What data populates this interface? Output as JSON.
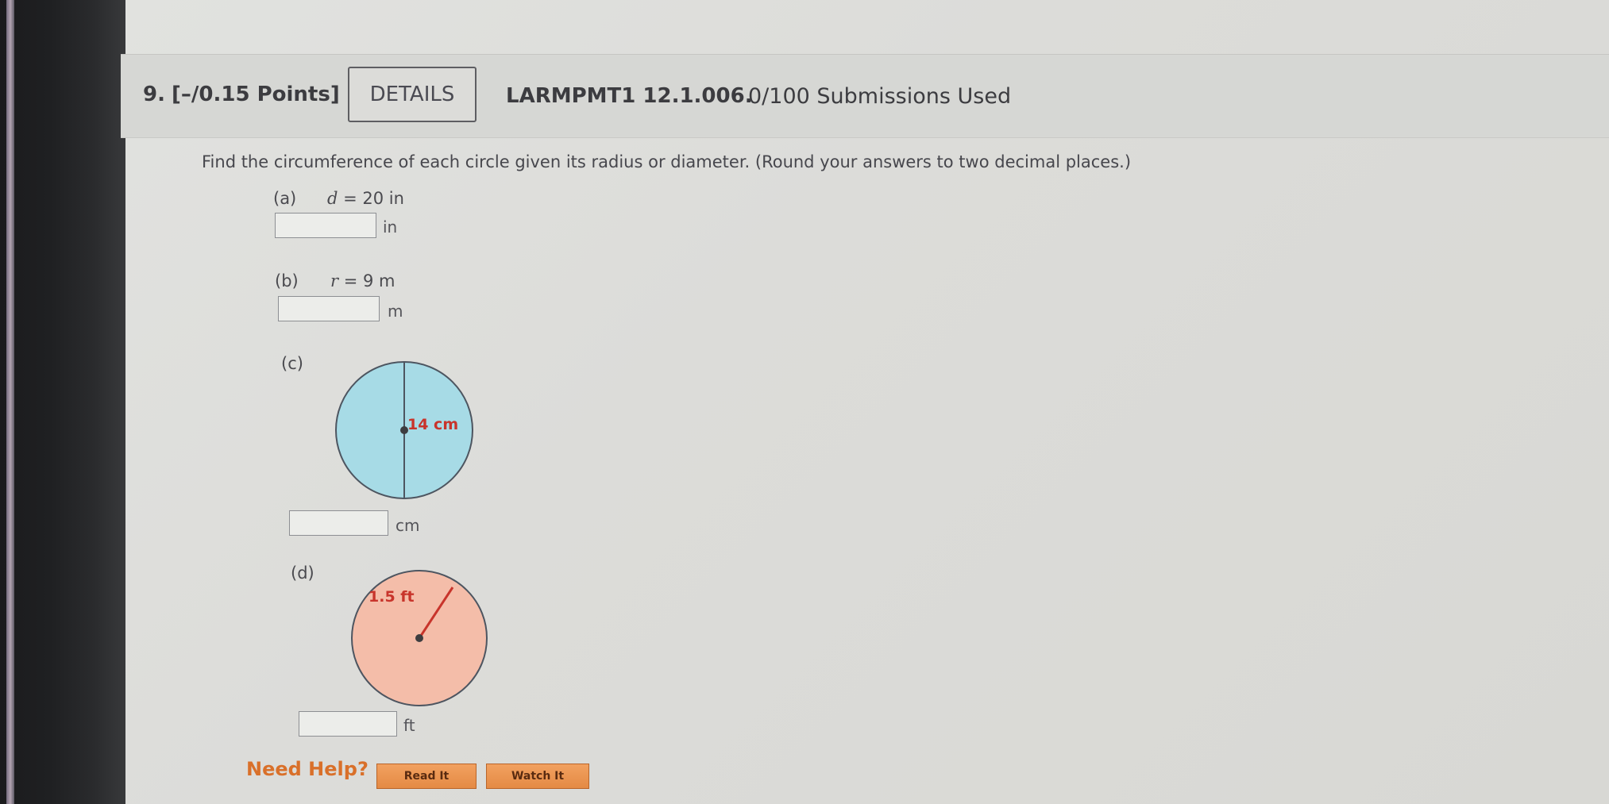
{
  "header": {
    "question_number": "9.",
    "points": "[–/0.15 Points]",
    "details_button": "DETAILS",
    "course_code": "LARMPMT1 12.1.006.",
    "submissions": "0/100 Submissions Used"
  },
  "question": {
    "instructions": "Find the circumference of each circle given its radius or diameter. (Round your answers to two decimal places.)",
    "parts": [
      {
        "label": "(a)",
        "variable": "d",
        "equals": "= 20 in",
        "answer": "",
        "unit": "in"
      },
      {
        "label": "(b)",
        "variable": "r",
        "equals": "= 9 m",
        "answer": "",
        "unit": "m"
      },
      {
        "label": "(c)",
        "measure": "14 cm",
        "answer": "",
        "unit": "cm",
        "circle_color": "#a7dbe6",
        "measure_color": "#c8342b"
      },
      {
        "label": "(d)",
        "measure": "1.5 ft",
        "answer": "",
        "unit": "ft",
        "circle_color": "#f4bda9",
        "measure_color": "#c8342b"
      }
    ]
  },
  "help": {
    "label": "Need Help?",
    "read_it": "Read It",
    "watch_it": "Watch It",
    "accent_color": "#e48a44"
  }
}
